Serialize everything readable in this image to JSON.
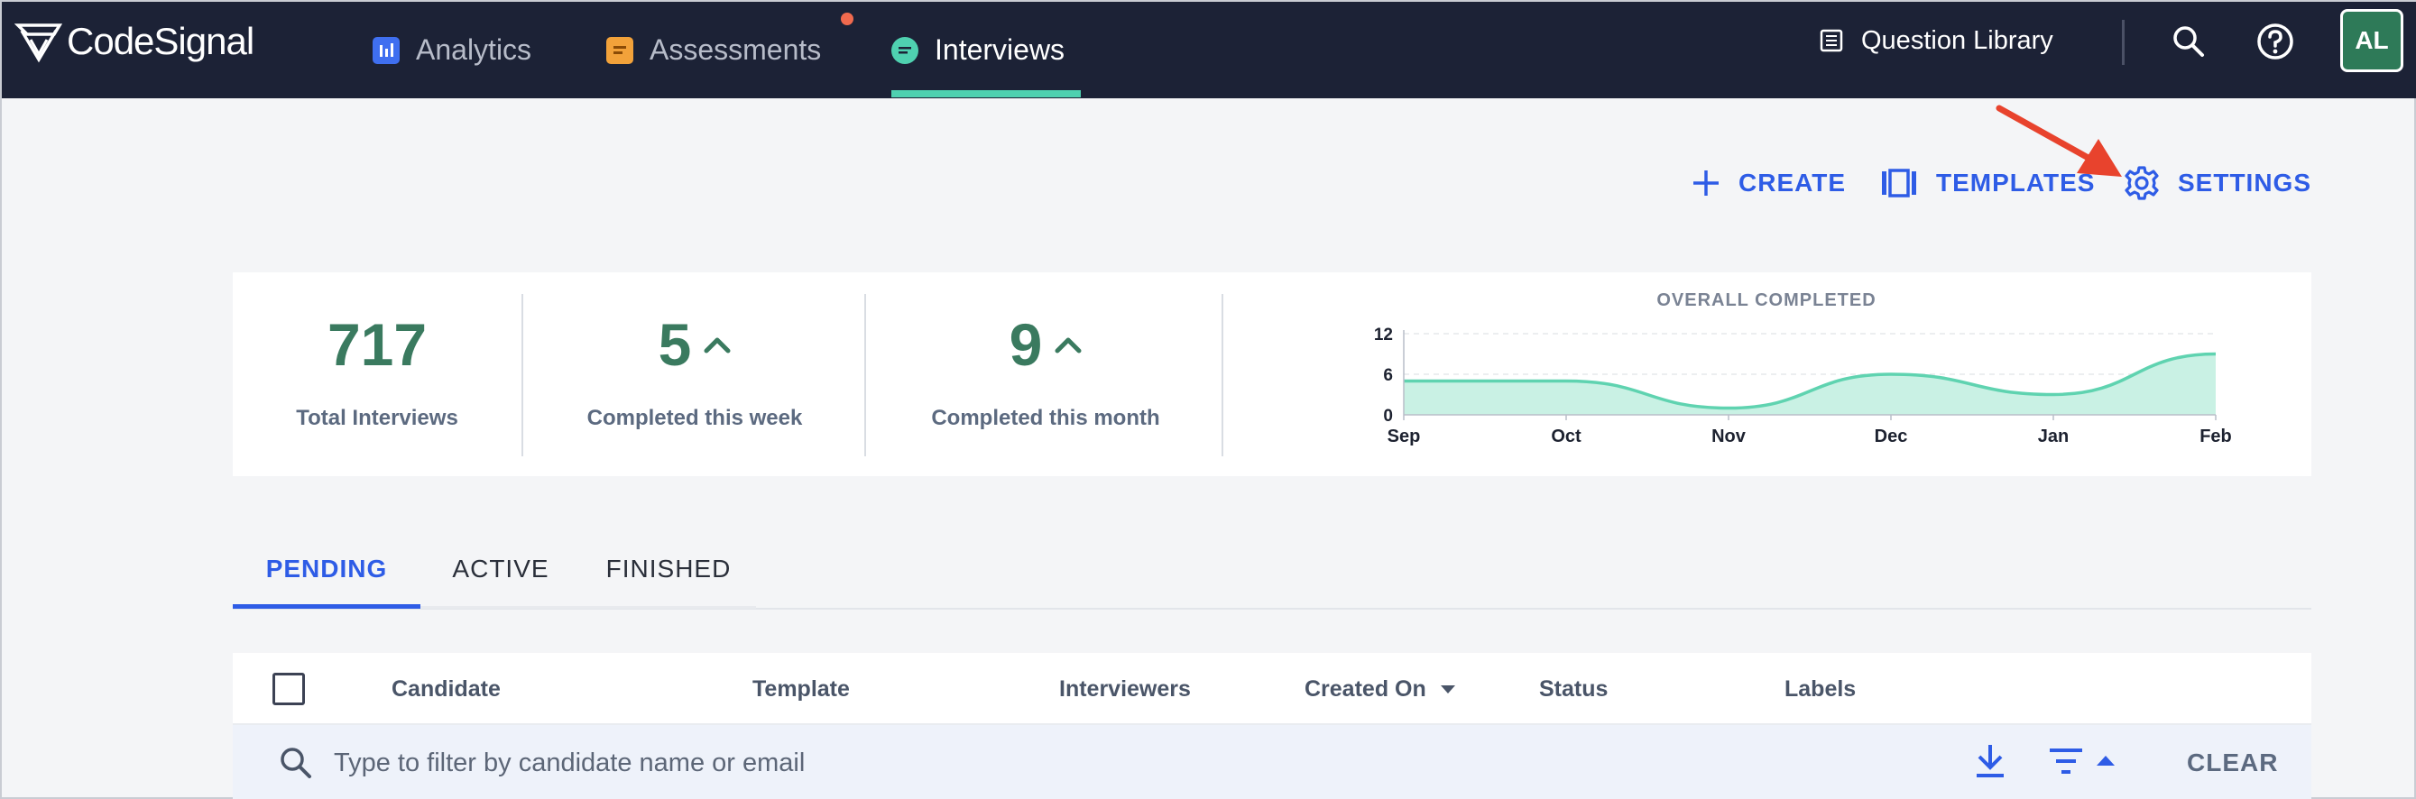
{
  "brand": {
    "name": "CodeSignal"
  },
  "nav": {
    "items": [
      {
        "label": "Analytics",
        "icon": "analytics-icon"
      },
      {
        "label": "Assessments",
        "icon": "assessments-icon"
      },
      {
        "label": "Interviews",
        "icon": "interviews-icon"
      }
    ],
    "active": "Interviews",
    "question_library": "Question Library",
    "avatar_initials": "AL"
  },
  "actions": {
    "create": "CREATE",
    "templates": "TEMPLATES",
    "settings": "SETTINGS"
  },
  "stats": [
    {
      "value": "717",
      "label": "Total Interviews",
      "trend": ""
    },
    {
      "value": "5",
      "label": "Completed this week",
      "trend": "up"
    },
    {
      "value": "9",
      "label": "Completed this month",
      "trend": "up"
    }
  ],
  "chart_data": {
    "type": "area",
    "title": "OVERALL COMPLETED",
    "x": [
      "Sep",
      "Oct",
      "Nov",
      "Dec",
      "Jan",
      "Feb"
    ],
    "yticks": [
      0,
      6,
      12
    ],
    "ylim": [
      0,
      12
    ],
    "series": [
      {
        "values": [
          5,
          5,
          1,
          6,
          3,
          9
        ]
      }
    ],
    "colors": {
      "line": "#5fd3b0",
      "fill": "#c9f1e4"
    }
  },
  "tabs": {
    "pending": "PENDING",
    "active": "ACTIVE",
    "finished": "FINISHED",
    "selected": "PENDING"
  },
  "table": {
    "columns": {
      "candidate": "Candidate",
      "template": "Template",
      "interviewers": "Interviewers",
      "created_on": "Created On",
      "status": "Status",
      "labels": "Labels"
    },
    "filter_placeholder": "Type to filter by candidate name or email",
    "clear": "CLEAR"
  },
  "colors": {
    "topbar": "#1c2236",
    "accent": "#2e5ce6",
    "stat_green": "#3a7a5f",
    "annotation_arrow": "#e8432d"
  }
}
